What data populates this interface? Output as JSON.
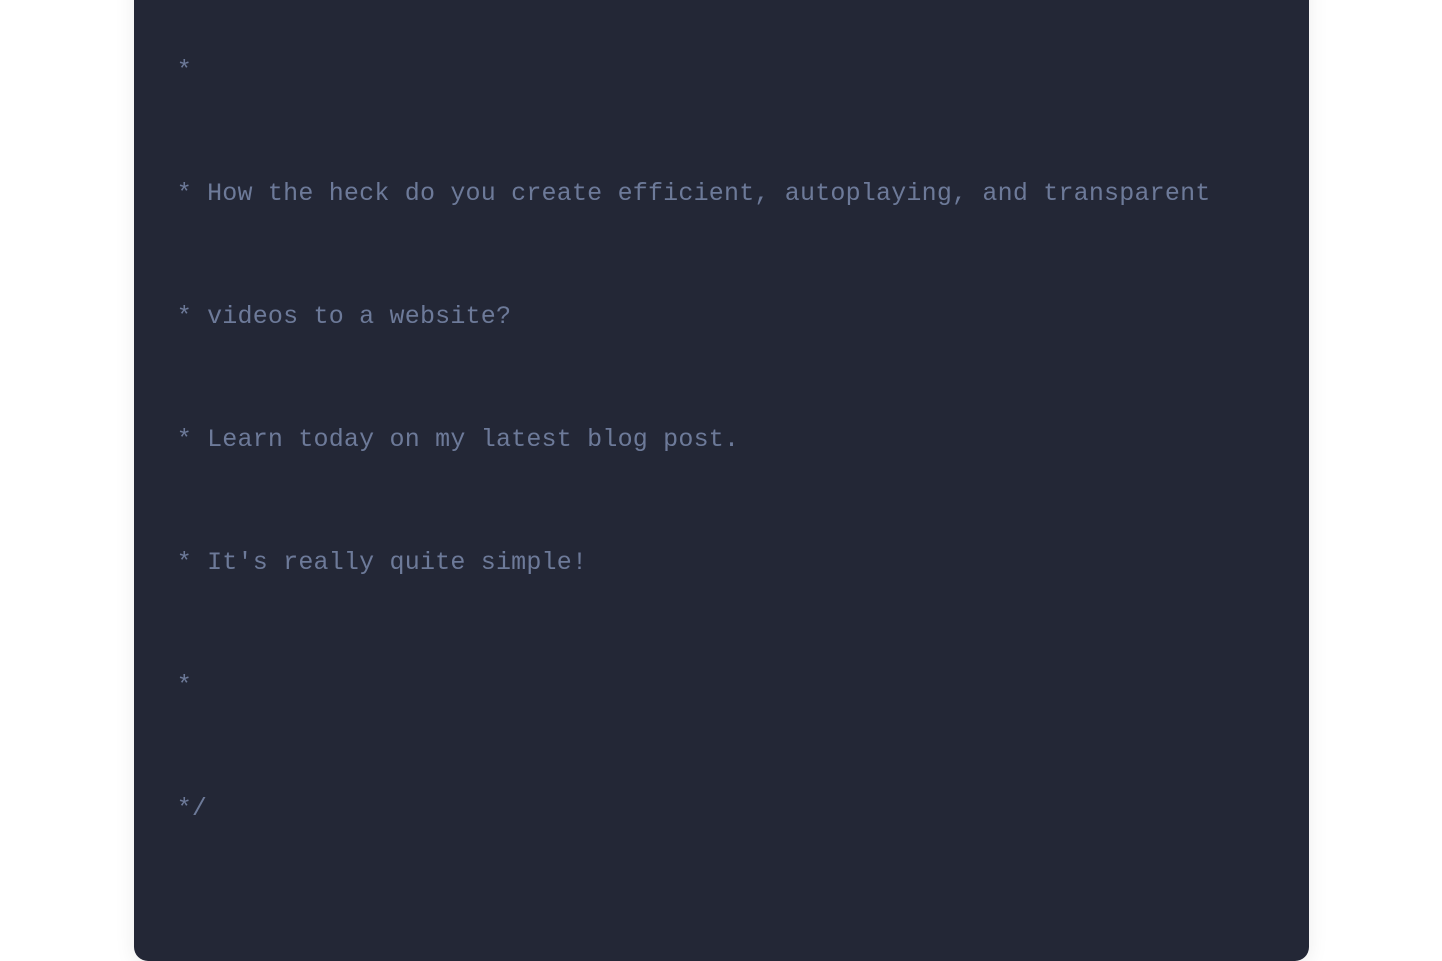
{
  "code": {
    "lines": [
      "/*",
      " *",
      " * How the heck do you create efficient, autoplaying, and transparent",
      " * videos to a website?",
      " * Learn today on my latest blog post.",
      " * It's really quite simple!",
      " *",
      " */"
    ]
  },
  "colors": {
    "windowBg": "#232736",
    "commentText": "#6d7a99",
    "red": "#ED6A5E",
    "yellow": "#F4BF4F",
    "green": "#61C554"
  }
}
